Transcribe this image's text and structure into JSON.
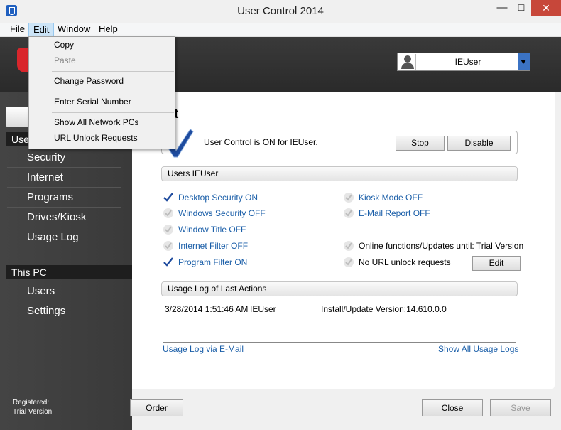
{
  "window": {
    "title": "User Control 2014",
    "minimize": "—",
    "maximize": "☐",
    "close": "✕"
  },
  "menubar": {
    "file": "File",
    "edit": "Edit",
    "window": "Window",
    "help": "Help"
  },
  "edit_menu": {
    "copy": "Copy",
    "paste": "Paste",
    "change_password": "Change Password",
    "serial": "Enter Serial Number",
    "show_all_pcs": "Show All Network PCs",
    "url_unlock": "URL Unlock Requests"
  },
  "header": {
    "user_selected": "IEUser"
  },
  "sidebar": {
    "users_section": "Use",
    "items": [
      "Security",
      "Internet",
      "Programs",
      "Drives/Kiosk",
      "Usage Log"
    ],
    "this_pc_section": "This PC",
    "pc_items": [
      "Users",
      "Settings"
    ],
    "registered_label": "Registered:",
    "registered_value": "Trial Version"
  },
  "main": {
    "title": "art",
    "status_text": "User Control is ON for IEUser.",
    "stop": "Stop",
    "disable": "Disable",
    "users_group": "Users IEUser",
    "features_left": [
      {
        "label": "Desktop Security ON",
        "checked": true
      },
      {
        "label": "Windows Security OFF",
        "checked": false
      },
      {
        "label": "Window Title OFF",
        "checked": false
      },
      {
        "label": "Internet Filter OFF",
        "checked": false
      },
      {
        "label": "Program Filter ON",
        "checked": true
      }
    ],
    "features_right": [
      {
        "label": "Kiosk Mode OFF",
        "checked": false
      },
      {
        "label": "E-Mail Report OFF",
        "checked": false
      },
      {
        "label": "Online functions/Updates until: Trial Version",
        "checked": false
      },
      {
        "label": "No URL unlock requests",
        "checked": false
      }
    ],
    "edit": "Edit",
    "log_group": "Usage Log of Last Actions",
    "log_rows": [
      {
        "time": "3/28/2014 1:51:46 AM",
        "user": "IEUser",
        "action": "Install/Update Version:14.610.0.0"
      }
    ],
    "log_link_email": "Usage Log via E-Mail",
    "log_link_all": "Show All Usage Logs"
  },
  "footer": {
    "order": "Order",
    "close": "Close",
    "save": "Save"
  }
}
